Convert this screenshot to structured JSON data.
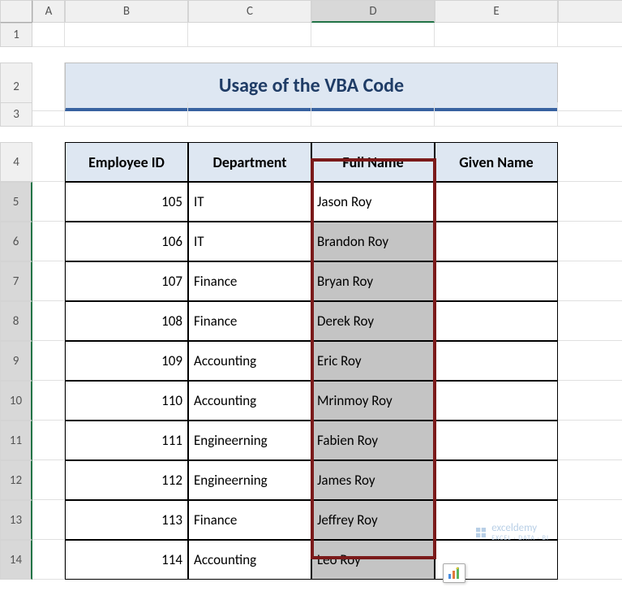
{
  "columns": [
    "",
    "A",
    "B",
    "C",
    "D",
    "E"
  ],
  "active_col": "D",
  "rows": [
    "1",
    "2",
    "3",
    "4",
    "5",
    "6",
    "7",
    "8",
    "9",
    "10",
    "11",
    "12",
    "13",
    "14"
  ],
  "active_rows": [
    "5",
    "6",
    "7",
    "8",
    "9",
    "10",
    "11",
    "12",
    "13",
    "14"
  ],
  "title": "Usage of the VBA Code",
  "headers": {
    "b": "Employee ID",
    "c": "Department",
    "d": "Full Name",
    "e": "Given Name"
  },
  "chart_data": {
    "type": "table",
    "columns": [
      "Employee ID",
      "Department",
      "Full Name",
      "Given Name"
    ],
    "rows": [
      {
        "id": 105,
        "dept": "IT",
        "name": "Jason Roy",
        "given": ""
      },
      {
        "id": 106,
        "dept": "IT",
        "name": "Brandon Roy",
        "given": ""
      },
      {
        "id": 107,
        "dept": "Finance",
        "name": "Bryan Roy",
        "given": ""
      },
      {
        "id": 108,
        "dept": "Finance",
        "name": "Derek Roy",
        "given": ""
      },
      {
        "id": 109,
        "dept": "Accounting",
        "name": "Eric Roy",
        "given": ""
      },
      {
        "id": 110,
        "dept": "Accounting",
        "name": "Mrinmoy Roy",
        "given": ""
      },
      {
        "id": 111,
        "dept": "Engineerning",
        "name": "Fabien Roy",
        "given": ""
      },
      {
        "id": 112,
        "dept": "Engineerning",
        "name": "James Roy",
        "given": ""
      },
      {
        "id": 113,
        "dept": "Finance",
        "name": "Jeffrey Roy",
        "given": ""
      },
      {
        "id": 114,
        "dept": "Accounting",
        "name": "Leo Roy",
        "given": ""
      }
    ]
  },
  "watermark": {
    "brand": "exceldemy",
    "sub": "EXCEL · DATA · BI"
  }
}
